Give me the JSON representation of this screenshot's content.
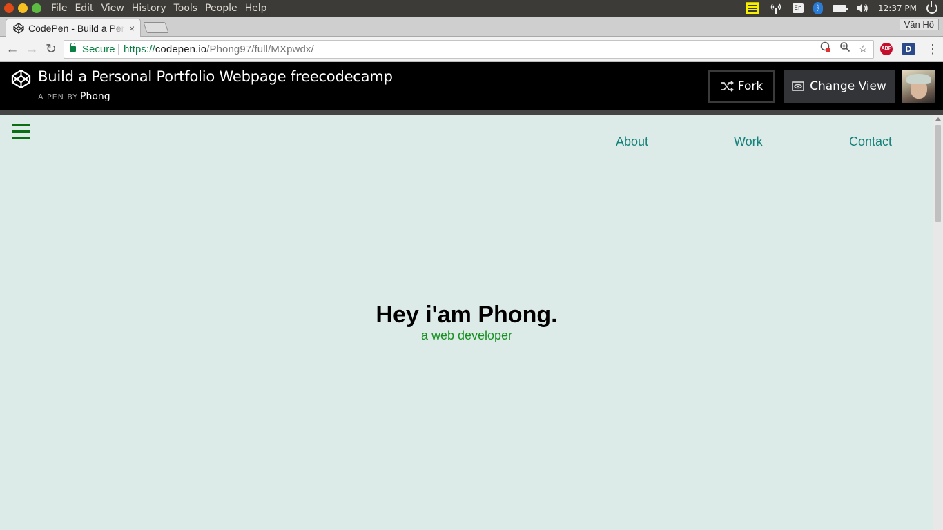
{
  "os_menubar": {
    "menus": [
      "File",
      "Edit",
      "View",
      "History",
      "Tools",
      "People",
      "Help"
    ],
    "indicators": {
      "notes_icon": "notes-icon",
      "network_icon": "network-icon",
      "keyboard_layout": "En",
      "bluetooth_icon": "bluetooth-icon",
      "battery_icon": "battery-icon",
      "volume_icon": "volume-icon",
      "power_icon": "power-icon"
    },
    "clock": "12:37 PM"
  },
  "browser": {
    "tab": {
      "title": "CodePen - Build a Personal Portfolio Webpage freecodecamp",
      "close": "×"
    },
    "profile_name": "Văn Hồ",
    "address": {
      "secure_label": "Secure",
      "url_scheme": "https://",
      "url_host": "codepen.io",
      "url_path": "/Phong97/full/MXpwdx/"
    },
    "extensions": {
      "abp": "ABP",
      "d": "D"
    }
  },
  "codepen": {
    "title": "Build a Personal Portfolio Webpage freecodecamp",
    "author_prefix": "A PEN BY",
    "author_name": "Phong",
    "fork_label": "Fork",
    "change_view_label": "Change View"
  },
  "page": {
    "nav": [
      "About",
      "Work",
      "Contact"
    ],
    "hero_title": "Hey i'am Phong.",
    "hero_subtitle": "a web developer"
  },
  "colors": {
    "page_bg": "#dcebe7",
    "nav_link": "#14817a",
    "subtitle": "#169121",
    "hamburger": "#0a6e12",
    "codepen_header": "#000000"
  }
}
